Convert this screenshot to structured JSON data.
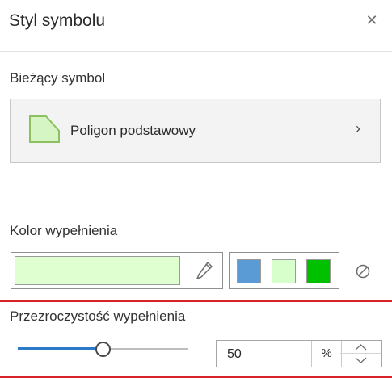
{
  "panel": {
    "title": "Styl symbolu",
    "close_icon": "close-icon"
  },
  "current_symbol": {
    "label": "Bieżący symbol",
    "name": "Poligon podstawowy",
    "icon": "polygon-icon",
    "chevron": "›"
  },
  "fill_color": {
    "label": "Kolor wypełnienia",
    "value_color": "#e0ffd0",
    "edit_icon": "pencil-icon",
    "recent_colors": [
      "#5b9bd5",
      "#d6ffcc",
      "#00c000"
    ],
    "no_color_icon": "no-color-icon"
  },
  "fill_transparency": {
    "label": "Przezroczystość wypełnienia",
    "value": "50",
    "unit": "%",
    "slider_fraction": 0.5
  },
  "accent": "#2b7ac9",
  "highlight": "#d8232a"
}
